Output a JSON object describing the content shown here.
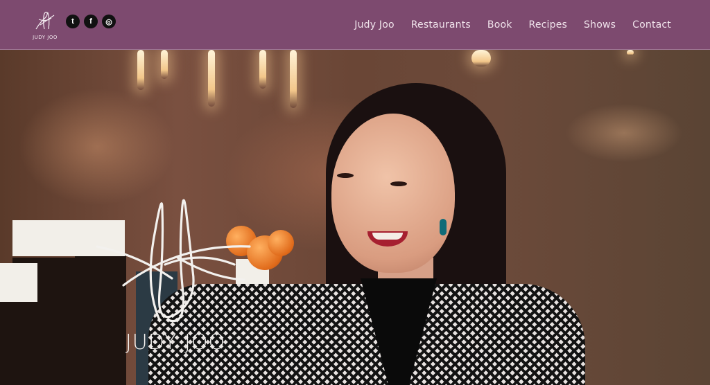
{
  "header": {
    "logo_text": "JUDY JOO",
    "social": [
      {
        "name": "twitter-icon",
        "glyph": "t"
      },
      {
        "name": "facebook-icon",
        "glyph": "f"
      },
      {
        "name": "instagram-icon",
        "glyph": "◎"
      }
    ],
    "nav": [
      "Judy Joo",
      "Restaurants",
      "Book",
      "Recipes",
      "Shows",
      "Contact"
    ]
  },
  "hero": {
    "logo_text": "JUDY JOO"
  },
  "colors": {
    "navbar_bg": "#7d4a6f",
    "nav_text": "#f1e4ec"
  }
}
